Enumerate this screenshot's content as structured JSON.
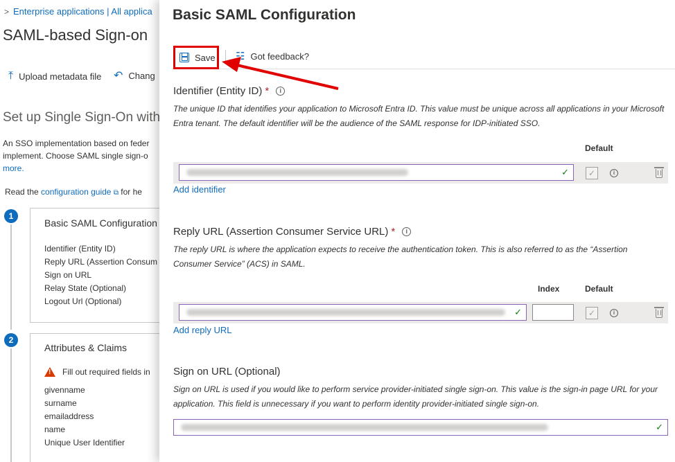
{
  "background": {
    "breadcrumb": {
      "text": "Enterprise applications | All applica"
    },
    "title": "SAML-based Sign-on",
    "toolbar": {
      "upload_label": "Upload metadata file",
      "change_label": "Chang"
    },
    "setup_heading": "Set up Single Sign-On with",
    "description": {
      "line1": "An SSO implementation based on feder",
      "line2": "implement. Choose SAML single sign-o",
      "more": "more."
    },
    "read": {
      "prefix": "Read the",
      "link": "configuration guide",
      "suffix": "for he"
    },
    "steps": [
      {
        "number": "1",
        "title": "Basic SAML Configuration",
        "fields": [
          "Identifier (Entity ID)",
          "Reply URL (Assertion Consum",
          "Sign on URL",
          "Relay State (Optional)",
          "Logout Url (Optional)"
        ]
      },
      {
        "number": "2",
        "title": "Attributes & Claims",
        "warning": "Fill out required fields in",
        "fields": [
          "givenname",
          "surname",
          "emailaddress",
          "name",
          "Unique User Identifier"
        ]
      }
    ]
  },
  "panel": {
    "title": "Basic SAML Configuration",
    "toolbar": {
      "save_label": "Save",
      "feedback_label": "Got feedback?"
    },
    "identifier": {
      "label": "Identifier (Entity ID)",
      "required_mark": "*",
      "description": "The unique ID that identifies your application to Microsoft Entra ID. This value must be unique across all applications in your Microsoft Entra tenant. The default identifier will be the audience of the SAML response for IDP-initiated SSO.",
      "default_header": "Default",
      "add_link": "Add identifier"
    },
    "reply_url": {
      "label": "Reply URL (Assertion Consumer Service URL)",
      "required_mark": "*",
      "description": "The reply URL is where the application expects to receive the authentication token. This is also referred to as the “Assertion Consumer Service” (ACS) in SAML.",
      "index_header": "Index",
      "default_header": "Default",
      "add_link": "Add reply URL"
    },
    "sign_on_url": {
      "label": "Sign on URL (Optional)",
      "description": "Sign on URL is used if you would like to perform service provider-initiated single sign-on. This value is the sign-in page URL for your application. This field is unnecessary if you want to perform identity provider-initiated single sign-on."
    }
  },
  "colors": {
    "accent": "#0f6cbd",
    "highlight": "#e00000",
    "field_border": "#8764b8",
    "valid": "#107c10"
  }
}
